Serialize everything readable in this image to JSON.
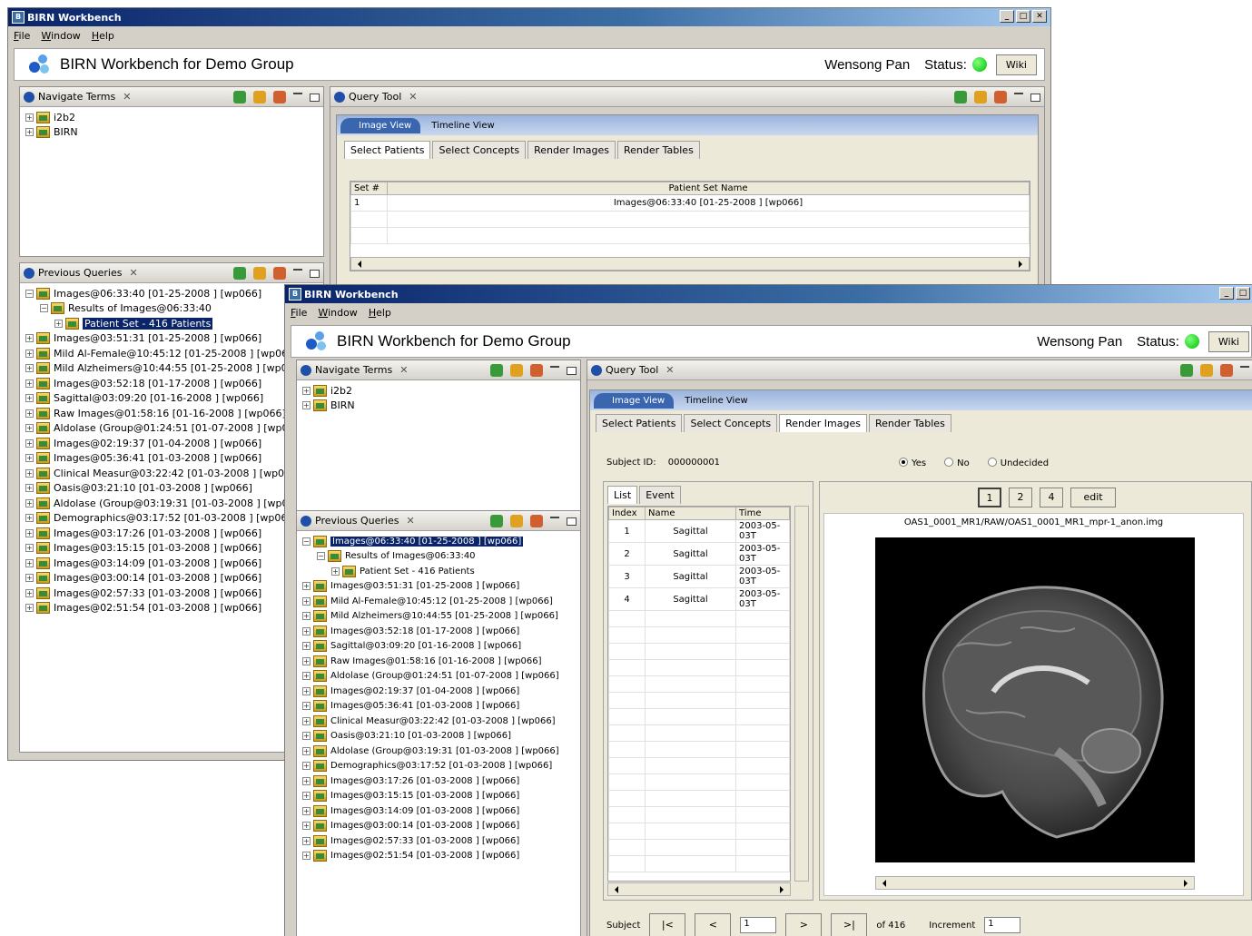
{
  "app": {
    "window_title": "BIRN Workbench",
    "menu": [
      "File",
      "Window",
      "Help"
    ],
    "banner_title": "BIRN Workbench for Demo Group",
    "user": "Wensong Pan",
    "status_label": "Status:",
    "wiki_label": "Wiki",
    "status_color": "#00c000"
  },
  "navigate": {
    "title": "Navigate Terms",
    "items": [
      "i2b2",
      "BIRN"
    ]
  },
  "previous": {
    "title": "Previous Queries",
    "root": "Images@06:33:40 [01-25-2008 ] [wp066]",
    "results_label": "Results of Images@06:33:40",
    "patient_set": "Patient Set - 416 Patients",
    "items": [
      "Images@03:51:31 [01-25-2008 ] [wp066]",
      "Mild Al-Female@10:45:12 [01-25-2008 ] [wp066]",
      "Mild Alzheimers@10:44:55 [01-25-2008 ] [wp066]",
      "Images@03:52:18 [01-17-2008 ] [wp066]",
      "Sagittal@03:09:20 [01-16-2008 ] [wp066]",
      "Raw Images@01:58:16 [01-16-2008 ] [wp066]",
      "Aldolase (Group@01:24:51 [01-07-2008 ] [wp066]",
      "Images@02:19:37 [01-04-2008 ] [wp066]",
      "Images@05:36:41 [01-03-2008 ] [wp066]",
      "Clinical Measur@03:22:42 [01-03-2008 ] [wp066]",
      "Oasis@03:21:10 [01-03-2008 ] [wp066]",
      "Aldolase (Group@03:19:31 [01-03-2008 ] [wp066]",
      "Demographics@03:17:52 [01-03-2008 ] [wp066]",
      "Images@03:17:26 [01-03-2008 ] [wp066]",
      "Images@03:15:15 [01-03-2008 ] [wp066]",
      "Images@03:14:09 [01-03-2008 ] [wp066]",
      "Images@03:00:14 [01-03-2008 ] [wp066]",
      "Images@02:57:33 [01-03-2008 ] [wp066]",
      "Images@02:51:54 [01-03-2008 ] [wp066]"
    ]
  },
  "query_tool": {
    "title": "Query Tool",
    "tab_image_view": "Image View",
    "tab_timeline": "Timeline View",
    "tabs": [
      "Select Patients",
      "Select Concepts",
      "Render Images",
      "Render Tables"
    ],
    "patient_table": {
      "headers": [
        "Set #",
        "Patient Set Name"
      ],
      "rows": [
        [
          "1",
          "Images@06:33:40 [01-25-2008 ] [wp066]"
        ]
      ]
    },
    "subject_label": "Subject ID:",
    "subject_id": "000000001",
    "radio": [
      "Yes",
      "No",
      "Undecided"
    ],
    "list_tabs": [
      "List",
      "Event"
    ],
    "image_headers": [
      "Index",
      "Name",
      "Time"
    ],
    "image_rows": [
      [
        "1",
        "Sagittal",
        "2003-05-03T"
      ],
      [
        "2",
        "Sagittal",
        "2003-05-03T"
      ],
      [
        "3",
        "Sagittal",
        "2003-05-03T"
      ],
      [
        "4",
        "Sagittal",
        "2003-05-03T"
      ]
    ],
    "layout_buttons": [
      "1",
      "2",
      "4",
      "edit"
    ],
    "image_file": "OAS1_0001_MR1/RAW/OAS1_0001_MR1_mpr-1_anon.img",
    "nav": {
      "subject_label": "Subject",
      "first": "|<",
      "prev": "<",
      "current": "1",
      "next": ">",
      "last": ">|",
      "of_label": "of 416",
      "increment_label": "Increment",
      "increment": "1"
    }
  }
}
